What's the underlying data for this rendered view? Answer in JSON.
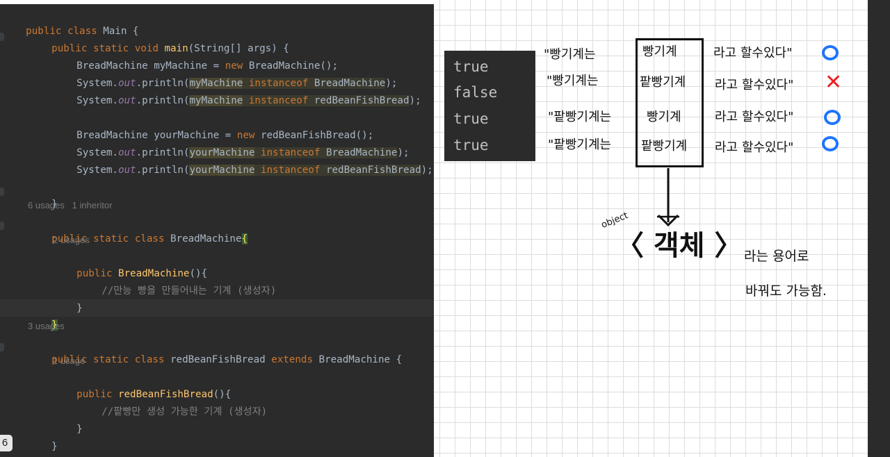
{
  "editor": {
    "code": {
      "l1": {
        "kw": "public class",
        "rest": " Main {"
      },
      "l2": {
        "kw": "public static void",
        "fn": "main",
        "rest": "(String[] args) {"
      },
      "l3": {
        "a": "BreadMachine myMachine = ",
        "kw": "new",
        "b": " BreadMachine();"
      },
      "l4": {
        "a": "System.",
        "it": "out",
        "b": ".println(",
        "v": "myMachine",
        "kw": " instanceof",
        "t": " BreadMachine",
        "c": ");"
      },
      "l5": {
        "a": "System.",
        "it": "out",
        "b": ".println(",
        "v": "myMachine",
        "kw": " instanceof",
        "t": " redBeanFishBread",
        "c": ");"
      },
      "l6": {
        "a": "BreadMachine yourMachine = ",
        "kw": "new",
        "b": " redBeanFishBread();"
      },
      "l7": {
        "a": "System.",
        "it": "out",
        "b": ".println(",
        "v": "yourMachine",
        "kw": " instanceof",
        "t": " BreadMachine",
        "c": ");"
      },
      "l8": {
        "a": "System.",
        "it": "out",
        "b": ".println(",
        "v": "yourMachine",
        "kw": " instanceof",
        "t": " redBeanFishBread",
        "c": ");"
      },
      "l9": "}",
      "l10": {
        "kw": "public static class",
        "rest": " BreadMachine",
        "brace": "{"
      },
      "l11": {
        "kw": "public",
        "fn": " BreadMachine",
        "rest": "(){"
      },
      "l12": "//만능 빵을 만들어내는 기계 (생성자)",
      "l13": "}",
      "l14": "}",
      "l15": {
        "kw": "public static class",
        "rest": " redBeanFishBread ",
        "kw2": "extends",
        "rest2": " BreadMachine {"
      },
      "l16": {
        "kw": "public",
        "fn": " redBeanFishBread",
        "rest": "(){"
      },
      "l17": "//팥빵만 생성 가능한 기계 (생성자)",
      "l18": "}",
      "l19": "}"
    },
    "hints": {
      "h1": "6 usages   1 inheritor",
      "h2": "2 usages",
      "h3": "3 usages",
      "h4": "1 usage"
    },
    "line_badge": "6"
  },
  "note": {
    "console_output": [
      "true",
      "false",
      "true",
      "true"
    ],
    "rows": [
      {
        "subject": "\"빵기계는",
        "middle": "빵기계",
        "ending": "라고  할수있다\"",
        "mark": "O"
      },
      {
        "subject": "\"빵기계는",
        "middle": "팥빵기계",
        "ending": "라고  할수있다\"",
        "mark": "X"
      },
      {
        "subject": "\"팥빵기계는",
        "middle": "빵기계",
        "ending": "라고  할수있다\"",
        "mark": "O"
      },
      {
        "subject": "\"팥빵기계는",
        "middle": "팥빵기계",
        "ending": "라고  할수있다\"",
        "mark": "O"
      }
    ],
    "object_label": "object",
    "term": "〈 객체 〉",
    "term_suffix": "라는 용어로",
    "term_line2": "바꿔도 가능함."
  },
  "colors": {
    "editor_bg": "#2b2b2b",
    "keyword": "#cc7832",
    "function": "#ffc66d",
    "mark_o": "#1e74ff",
    "mark_x": "#ee2020"
  }
}
